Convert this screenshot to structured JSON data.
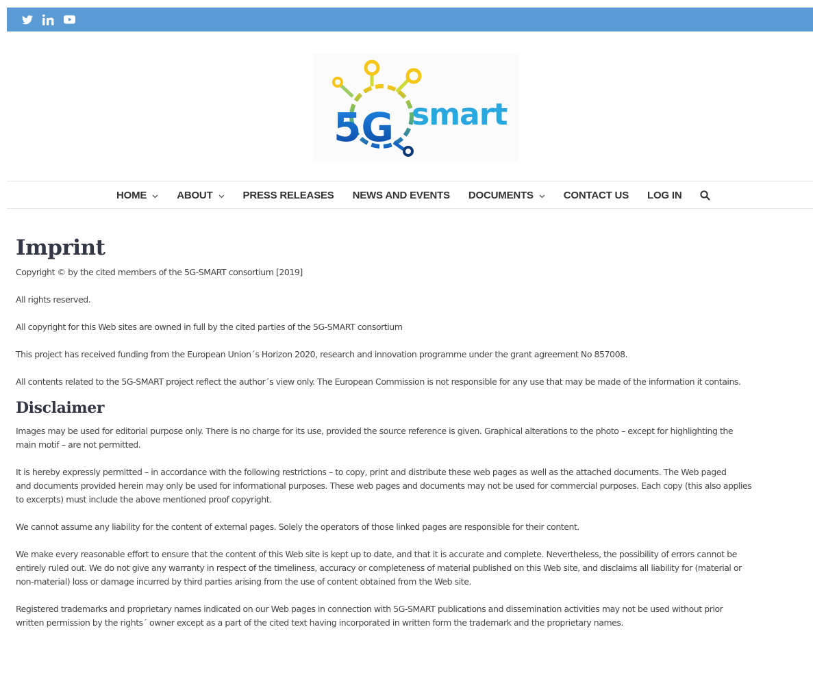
{
  "topbar": {
    "bg_color": "#5b9bd5",
    "social": [
      {
        "icon": "twitter-icon"
      },
      {
        "icon": "linkedin-icon"
      },
      {
        "icon": "youtube-icon"
      }
    ]
  },
  "logo": {
    "text_5g": "5G",
    "text_smart": "smart",
    "colors": {
      "yellow": "#f5c518",
      "green": "#4caf50",
      "blue": "#1e6fc7",
      "cyan": "#29a8e0",
      "navy": "#123c7a"
    }
  },
  "nav": {
    "items": [
      {
        "label": "HOME",
        "has_dropdown": true
      },
      {
        "label": "ABOUT",
        "has_dropdown": true
      },
      {
        "label": "PRESS RELEASES",
        "has_dropdown": false
      },
      {
        "label": "NEWS AND EVENTS",
        "has_dropdown": false
      },
      {
        "label": "DOCUMENTS",
        "has_dropdown": true
      },
      {
        "label": "CONTACT US",
        "has_dropdown": false
      },
      {
        "label": "LOG IN",
        "has_dropdown": false
      }
    ],
    "search_icon": "search-icon"
  },
  "content": {
    "title": "Imprint",
    "imprint_paragraphs": [
      "Copyright © by the cited members of the 5G-SMART consortium [2019]",
      "All rights reserved.",
      "All copyright for this Web sites are owned in full by the cited parties of the 5G-SMART consortium",
      "This project has received funding from the European Union´s Horizon 2020, research and innovation programme under the grant agreement No 857008.",
      "All contents related to the 5G-SMART project reflect the author´s view only. The European Commission is not responsible for any use that may be made of the information it contains."
    ],
    "disclaimer_title": "Disclaimer",
    "disclaimer_paragraphs": [
      [
        "Images may be used for editorial purpose only. There is no charge for its use, provided the source reference is given. Graphical alterations to the photo – except for highlighting the",
        "main motif – are not permitted."
      ],
      [
        "It is hereby expressly permitted – in accordance with the following restrictions – to copy, print and distribute these web pages as well as the attached documents. The Web paged",
        "and documents provided herein may only be used for informational purposes. These web pages and documents may not be used for commercial purposes. Each copy (this also applies",
        "to excerpts) must include the above mentioned proof copyright."
      ],
      [
        "We cannot assume any liability for the content of external pages. Solely the operators of those linked pages are responsible for their content."
      ],
      [
        "We make every reasonable effort to ensure that the content of this Web site is kept up to date, and that it is accurate and complete. Nevertheless, the possibility of errors cannot be",
        "entirely ruled out. We do not give any warranty in respect of the timeliness, accuracy or completeness of material published on this Web site, and disclaims all liability for (material or",
        "non-material) loss or damage incurred by third parties arising from the use of content obtained from the Web site."
      ],
      [
        "Registered trademarks and proprietary names indicated on our Web pages in connection with 5G-SMART publications and dissemination activities may not be used without prior",
        "written permission by the rights´ owner except as a part of the cited text having incorporated in written form the trademark and the proprietary names."
      ]
    ]
  }
}
